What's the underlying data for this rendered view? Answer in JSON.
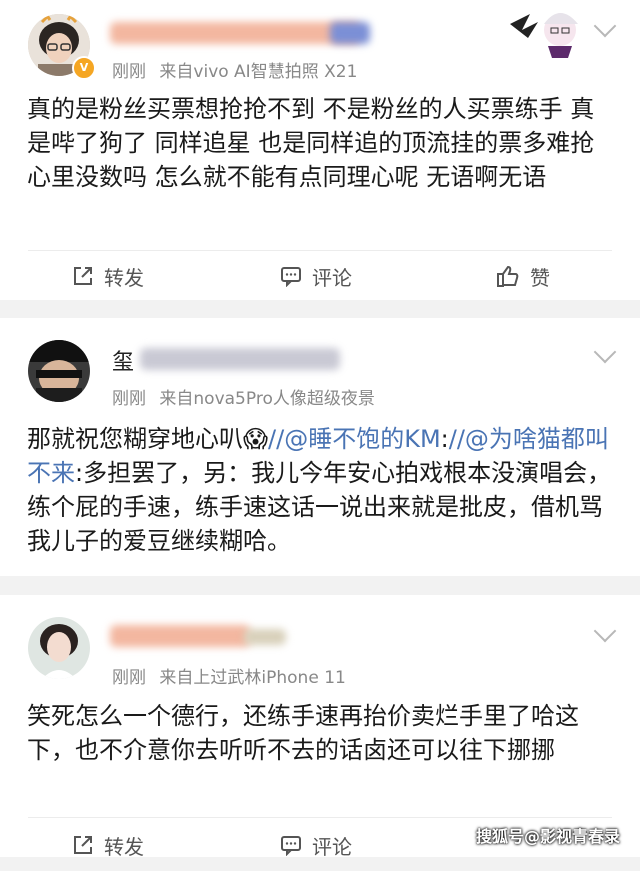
{
  "posts": [
    {
      "time": "刚刚",
      "source": "来自vivo AI智慧拍照 X21",
      "body": "真的是粉丝买票想抢抢不到 不是粉丝的人买票练手 真是哔了狗了 同样追星 也是同样追的顶流挂的票多难抢心里没数吗 怎么就不能有点同理心呢 无语啊无语",
      "actions": {
        "repost": "转发",
        "comment": "评论",
        "like": "赞"
      }
    },
    {
      "name_visible": "玺",
      "time": "刚刚",
      "source": "来自nova5Pro人像超级夜景",
      "body_before": "那就祝您糊穿地心叭",
      "emoji": "😱",
      "mention1": "//@睡不饱的KM",
      "mention_sep": ":",
      "mention2": "//@为啥猫都叫不来",
      "body_after": ":多担罢了，另：我儿今年安心拍戏根本没演唱会，练个屁的手速，练手速这话一说出来就是批皮，借机骂我儿子的爱豆继续糊哈。"
    },
    {
      "time": "刚刚",
      "source": "来自上过武林iPhone 11",
      "body": "笑死怎么一个德行，还练手速再抬价卖烂手里了哈这下，也不介意你去听听不去的话卤还可以往下挪挪",
      "actions": {
        "repost": "转发",
        "comment": "评论"
      }
    }
  ],
  "watermark": "搜狐号@影视青春录",
  "colors": {
    "mention": "#4a74b4",
    "meta": "#888888",
    "badge": "#f5a623"
  }
}
